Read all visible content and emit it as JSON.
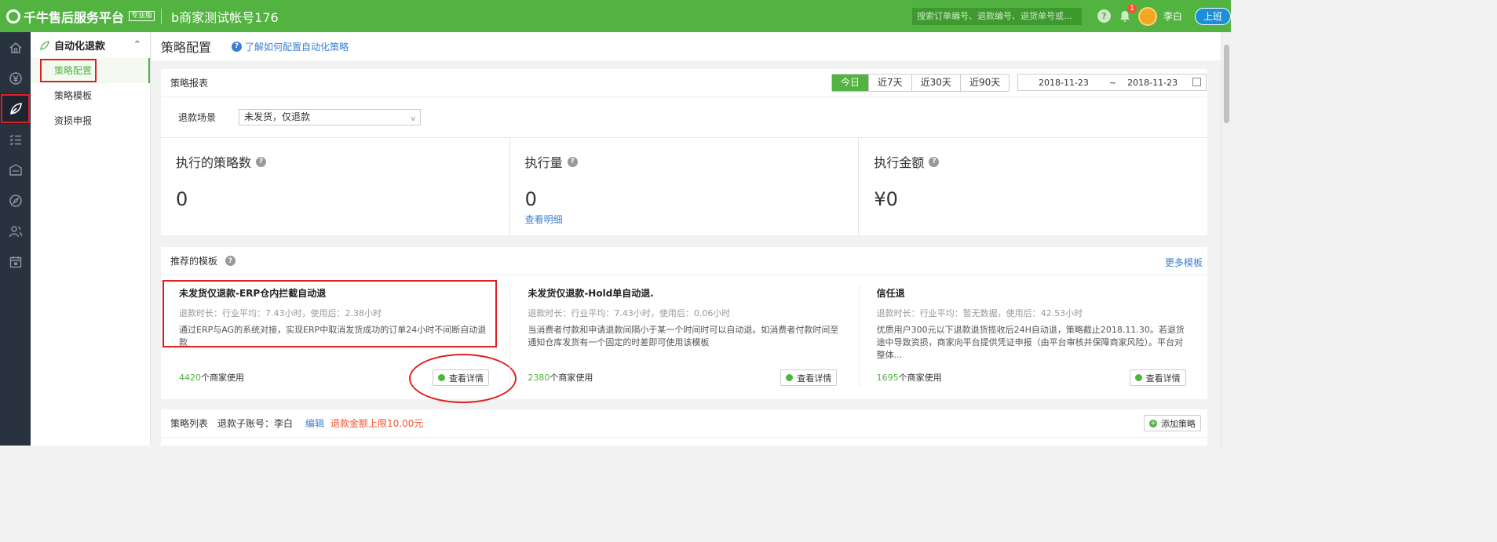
{
  "topbar": {
    "logo_text": "千牛售后服务平台",
    "logo_badge": "专业版",
    "account_title": "b商家测试帐号176",
    "search_placeholder": "搜索订单编号、退款编号、退货单号或...",
    "help_glyph": "?",
    "notification_count": "1",
    "user_name": "李白",
    "status_button": "上班"
  },
  "iconbar": {
    "items": [
      "home-icon",
      "money-icon",
      "leaf-icon",
      "list-icon",
      "ticket-icon",
      "compass-icon",
      "users-icon",
      "calendar-icon"
    ],
    "active_index": 2
  },
  "subnav": {
    "header": "自动化退款",
    "items": [
      {
        "label": "策略配置",
        "active": true
      },
      {
        "label": "策略模板",
        "active": false
      },
      {
        "label": "资损申报",
        "active": false
      }
    ]
  },
  "page": {
    "title": "策略配置",
    "help_link": "了解如何配置自动化策略"
  },
  "report": {
    "title": "策略报表",
    "ranges": [
      "今日",
      "近7天",
      "近30天",
      "近90天"
    ],
    "active_range": "今日",
    "date_start": "2018-11-23",
    "date_sep": "~",
    "date_end": "2018-11-23",
    "scene_label": "退款场景",
    "scene_value": "未发货，仅退款",
    "stats": [
      {
        "title": "执行的策略数",
        "value": "0"
      },
      {
        "title": "执行量",
        "value": "0",
        "link": "查看明细"
      },
      {
        "title": "执行金额",
        "value": "¥0"
      }
    ]
  },
  "templates": {
    "title": "推荐的模板",
    "more": "更多模板",
    "items": [
      {
        "title": "未发货仅退款-ERP仓内拦截自动退",
        "meta": "退款时长：行业平均：7.43小时，使用后：2.38小时",
        "desc": "通过ERP与AG的系统对接，实现ERP中取消发货成功的订单24小时不间断自动退款",
        "count": "4420",
        "count_suffix": "个商家使用",
        "button": "查看详情"
      },
      {
        "title": "未发货仅退款-Hold单自动退.",
        "meta": "退款时长：行业平均：7.43小时，使用后：0.06小时",
        "desc": "当消费者付款和申请退款间隔小于某一个时间时可以自动退。如消费者付款时间至通知仓库发货有一个固定的时差即可使用该模板",
        "count": "2380",
        "count_suffix": "个商家使用",
        "button": "查看详情"
      },
      {
        "title": "信任退",
        "meta": "退款时长：行业平均：暂无数据，使用后：42.53小时",
        "desc": "优质用户300元以下退款退货揽收后24H自动退，策略截止2018.11.30。若退货途中导致资损，商家向平台提供凭证申报（由平台审核并保障商家风险）。平台对整体...",
        "count": "1695",
        "count_suffix": "个商家使用",
        "button": "查看详情"
      }
    ]
  },
  "strategy_list": {
    "title": "策略列表",
    "account": "退款子账号：李白",
    "edit": "编辑",
    "limit": "退款金额上限10.00元",
    "add_button": "添加策略"
  },
  "colors": {
    "brand_green": "#52b341",
    "link_blue": "#3a7fd5",
    "sidebar_dark": "#293340",
    "highlight_red": "#e02020",
    "warning_orange": "#f5542e"
  }
}
